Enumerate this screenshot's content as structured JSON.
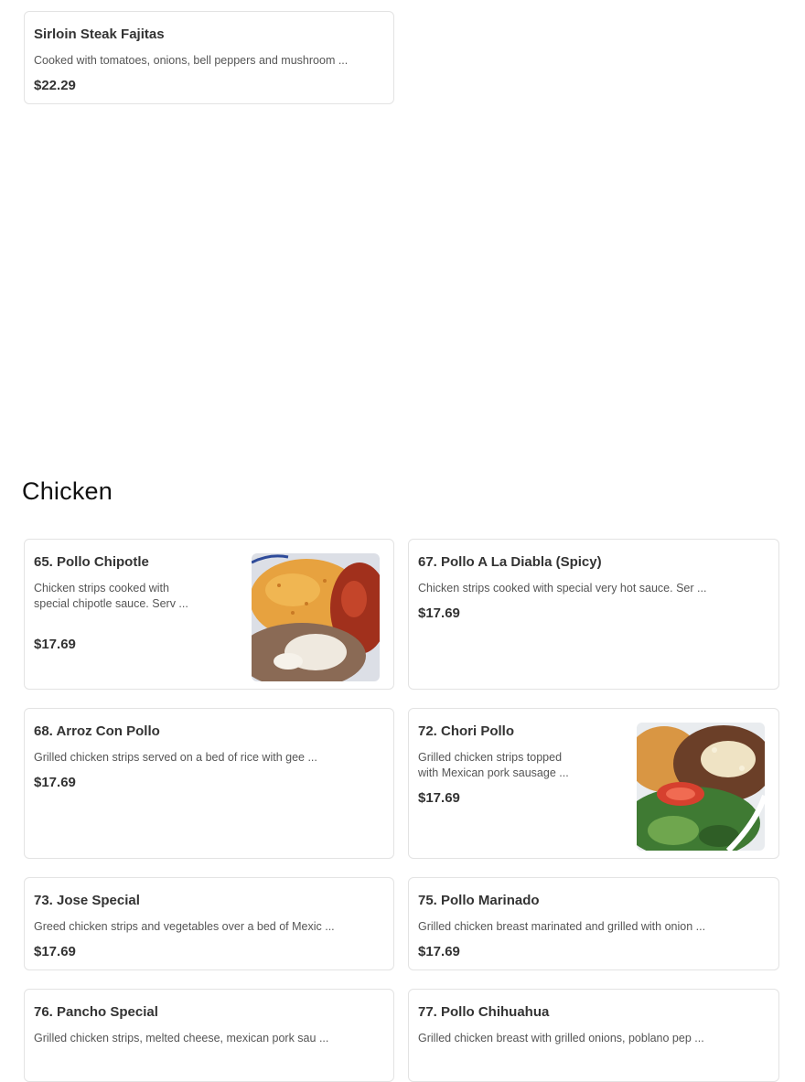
{
  "items": {
    "sirloin": {
      "name": "Sirloin Steak Fajitas",
      "desc": "Cooked with tomatoes, onions, bell peppers and mushroom ...",
      "price": "$22.29"
    },
    "pollo_chipotle": {
      "name": "65. Pollo Chipotle",
      "desc": "Chicken strips cooked with special chipotle sauce. Serv ...",
      "price": "$17.69",
      "image_icon": "food-photo-rice-beans-chicken"
    },
    "pollo_diabla": {
      "name": "67. Pollo A La Diabla (Spicy)",
      "desc": "Chicken strips cooked with special very hot sauce. Ser ...",
      "price": "$17.69"
    },
    "arroz_con_pollo": {
      "name": "68. Arroz Con Pollo",
      "desc": "Grilled chicken strips served on a bed of rice with gee ...",
      "price": "$17.69"
    },
    "chori_pollo": {
      "name": "72. Chori Pollo",
      "desc": "Grilled chicken strips topped with Mexican pork sausage ...",
      "price": "$17.69",
      "image_icon": "food-photo-chicken-salad-tomato"
    },
    "jose_special": {
      "name": "73. Jose Special",
      "desc": "Greed chicken strips and vegetables over a bed of Mexic ...",
      "price": "$17.69"
    },
    "pollo_marinado": {
      "name": "75. Pollo Marinado",
      "desc": "Grilled chicken breast marinated and grilled with onion ...",
      "price": "$17.69"
    },
    "pancho_special": {
      "name": "76. Pancho Special",
      "desc": "Grilled chicken strips, melted cheese, mexican pork sau ..."
    },
    "pollo_chihuahua": {
      "name": "77. Pollo Chihuahua",
      "desc": "Grilled chicken breast with grilled onions, poblano pep ..."
    }
  },
  "sections": {
    "chicken_title": "Chicken"
  },
  "colors": {
    "card_border": "#e3e3e3",
    "text": "#333333",
    "muted": "#555555"
  }
}
